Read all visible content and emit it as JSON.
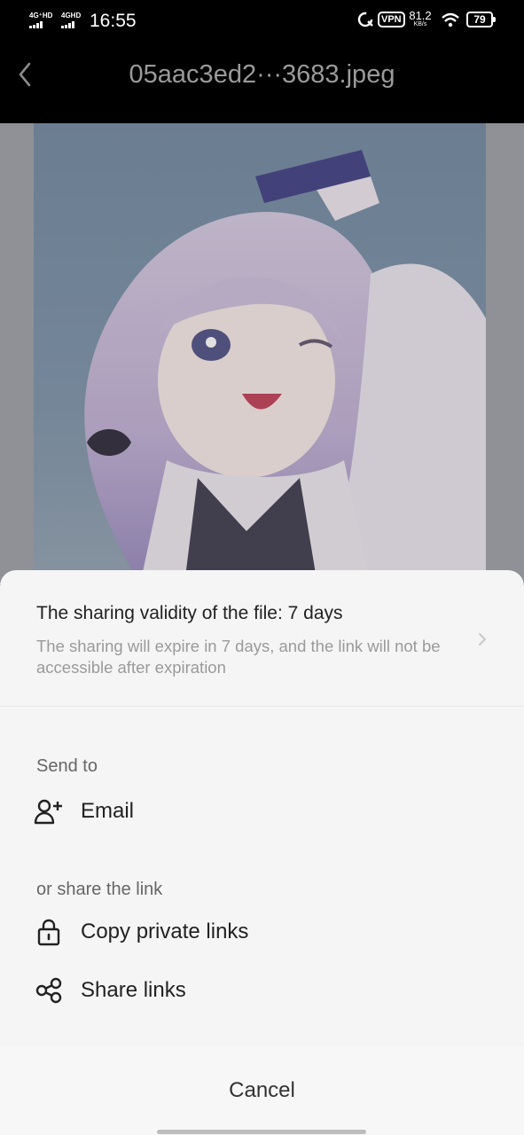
{
  "status_bar": {
    "net1": "4G⁺HD",
    "net2": "4GHD",
    "time": "16:55",
    "vpn": "VPN",
    "speed_value": "81.2",
    "speed_unit": "KB/s",
    "battery": "79"
  },
  "header": {
    "title": "05aac3ed2···3683.jpeg",
    "back_icon": "chevron-left-icon"
  },
  "sheet": {
    "validity_title": "The sharing validity of the file: 7 days",
    "validity_desc": "The sharing will expire in 7 days, and the link will not be accessible after expiration",
    "send_to_label": "Send to",
    "email_label": "Email",
    "or_share_label": "or share the link",
    "copy_private_label": "Copy private links",
    "share_links_label": "Share links",
    "cancel_label": "Cancel"
  },
  "colors": {
    "sheet_bg": "#f5f5f5",
    "text_primary": "#222222",
    "text_secondary": "#9a9a9a"
  }
}
